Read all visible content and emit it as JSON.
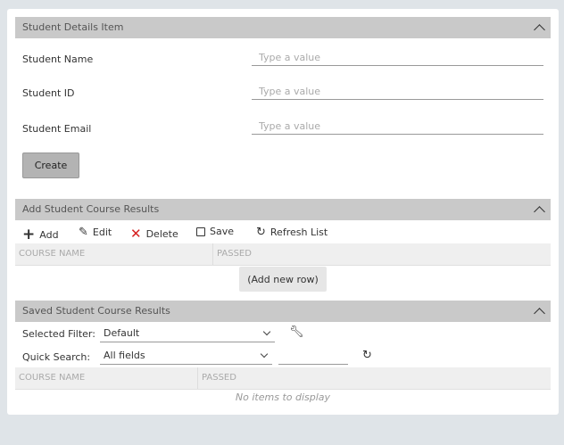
{
  "details": {
    "title": "Student Details Item",
    "fields": [
      {
        "label": "Student Name",
        "placeholder": "Type a value"
      },
      {
        "label": "Student ID",
        "placeholder": "Type a value"
      },
      {
        "label": "Student Email",
        "placeholder": "Type a value"
      }
    ],
    "create_label": "Create"
  },
  "add_results": {
    "title": "Add Student Course Results",
    "toolbar": {
      "add": "Add",
      "edit": "Edit",
      "delete": "Delete",
      "save": "Save",
      "refresh": "Refresh List"
    },
    "columns": [
      "COURSE NAME",
      "PASSED"
    ],
    "add_row_label": "(Add new row)"
  },
  "saved_results": {
    "title": "Saved Student Course Results",
    "filter_label": "Selected Filter:",
    "filter_value": "Default",
    "search_label": "Quick Search:",
    "search_scope": "All fields",
    "search_value": "",
    "columns": [
      "COURSE NAME",
      "PASSED"
    ],
    "empty_text": "No items to display"
  },
  "colors": {
    "delete": "#d62020",
    "header": "#c9c9c9"
  }
}
